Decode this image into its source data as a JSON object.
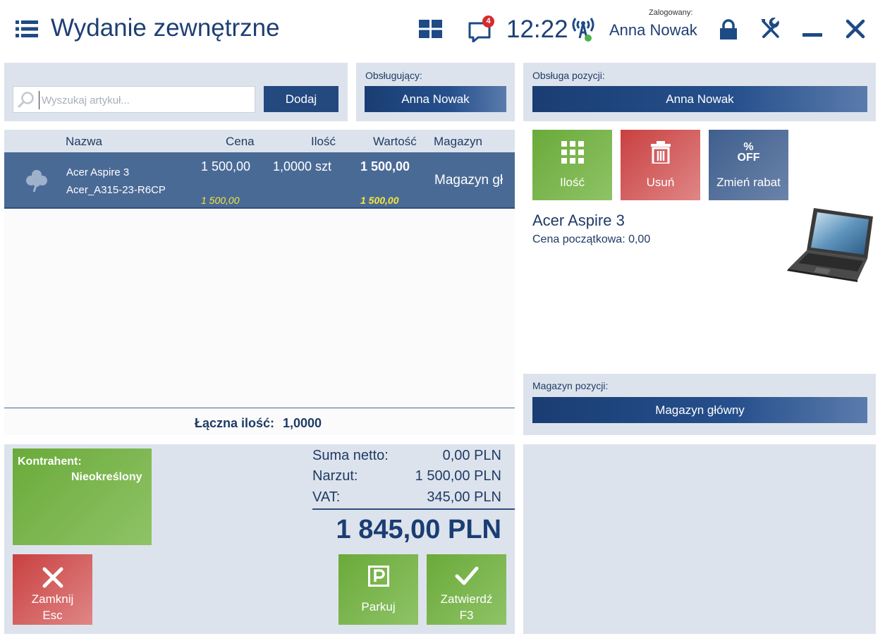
{
  "header": {
    "title": "Wydanie zewnętrzne",
    "notifications_count": "4",
    "clock": "12:22",
    "logged_in_label": "Zalogowany:",
    "logged_in_user": "Anna Nowak"
  },
  "search": {
    "placeholder": "Wyszukaj artykuł...",
    "add_label": "Dodaj"
  },
  "served_by": {
    "label": "Obsługujący:",
    "value": "Anna Nowak"
  },
  "position_service": {
    "label": "Obsługa pozycji:",
    "value": "Anna Nowak"
  },
  "table": {
    "columns": [
      "Nazwa",
      "Cena",
      "Ilość",
      "Wartość",
      "Magazyn"
    ],
    "rows": [
      {
        "name": "Acer Aspire 3",
        "code": "Acer_A315-23-R6CP",
        "price": "1 500,00",
        "price_secondary": "1 500,00",
        "quantity": "1,0000 szt",
        "value": "1 500,00",
        "value_secondary": "1 500,00",
        "warehouse": "Magazyn gł"
      }
    ],
    "total_qty_label": "Łączna ilość:",
    "total_qty_value": "1,0000"
  },
  "actions": {
    "quantity": "Ilość",
    "delete": "Usuń",
    "discount": "Zmień rabat",
    "discount_icon_top": "%",
    "discount_icon_bottom": "OFF"
  },
  "product_details": {
    "name": "Acer Aspire 3",
    "start_price": "Cena początkowa: 0,00"
  },
  "position_warehouse": {
    "label": "Magazyn pozycji:",
    "value": "Magazyn główny"
  },
  "customer": {
    "label": "Kontrahent:",
    "value": "Nieokreślony"
  },
  "summary": {
    "net_label": "Suma netto:",
    "net_value": "0,00 PLN",
    "markup_label": "Narzut:",
    "markup_value": "1 500,00 PLN",
    "vat_label": "VAT:",
    "vat_value": "345,00 PLN",
    "grand_total": "1 845,00 PLN"
  },
  "bottom_actions": {
    "close_label": "Zamknij",
    "close_shortcut": "Esc",
    "park_label": "Parkuj",
    "confirm_label": "Zatwierdź",
    "confirm_shortcut": "F3"
  },
  "colors": {
    "primary": "#1e3f73",
    "panel": "#dde3ec",
    "selected_row": "#4a6a96",
    "green": "#7ab450",
    "red": "#d35a5a",
    "highlight_yellow": "#f5e63a"
  }
}
